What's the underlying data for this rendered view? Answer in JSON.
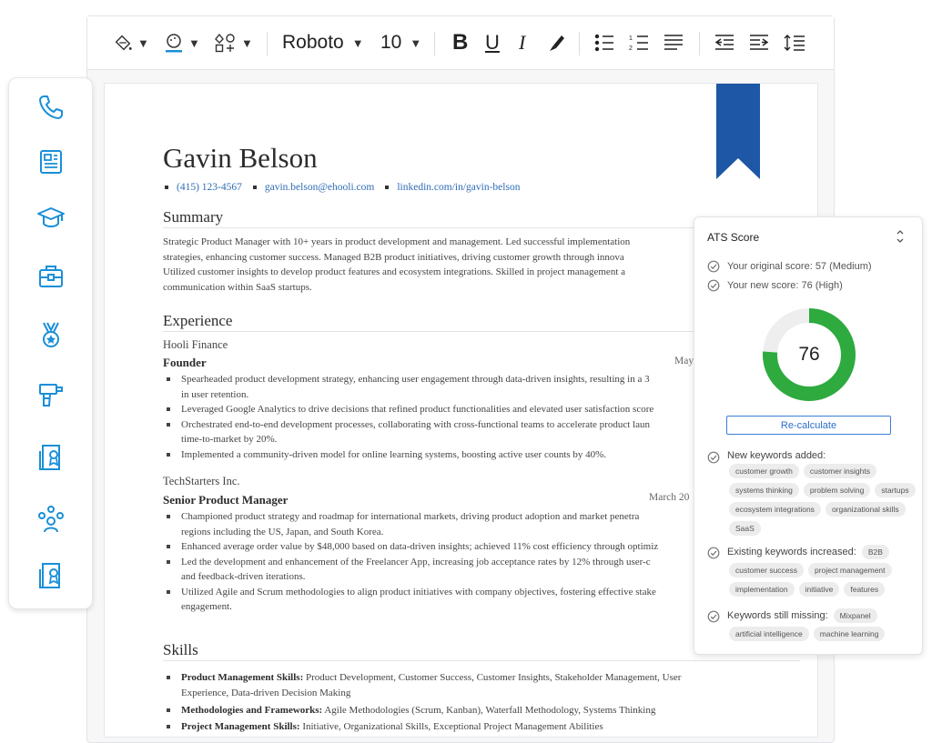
{
  "toolbar": {
    "font_family": "Roboto",
    "font_size": "10",
    "bold": "B",
    "underline": "U",
    "italic": "I"
  },
  "sidebar": {
    "items": [
      {
        "icon": "phone-icon"
      },
      {
        "icon": "summary-icon"
      },
      {
        "icon": "education-icon"
      },
      {
        "icon": "briefcase-icon"
      },
      {
        "icon": "award-icon"
      },
      {
        "icon": "tools-icon"
      },
      {
        "icon": "certificate-icon"
      },
      {
        "icon": "team-icon"
      },
      {
        "icon": "certificate-icon"
      }
    ],
    "accent": "#1a8fd8"
  },
  "resume": {
    "name": "Gavin Belson",
    "phone": "(415) 123-4567",
    "email": "gavin.belson@ehooli.com",
    "linkedin": "linkedin.com/in/gavin-belson",
    "summary_title": "Summary",
    "summary_lines": [
      "Strategic Product Manager with 10+ years in product development and management. Led successful implementation",
      "strategies, enhancing customer success. Managed B2B product initiatives, driving customer growth through innova",
      "Utilized customer insights to develop product features and ecosystem integrations. Skilled in project management a",
      "communication within SaaS startups."
    ],
    "experience_title": "Experience",
    "jobs": [
      {
        "company": "Hooli Finance",
        "role": "Founder",
        "date": "May",
        "bullets": [
          [
            "Spearheaded product development strategy, enhancing user engagement through data-driven insights, resulting in a 3",
            "in user retention."
          ],
          [
            "Leveraged Google Analytics to drive decisions that refined product functionalities and elevated user satisfaction score"
          ],
          [
            "Orchestrated end-to-end development processes, collaborating with cross-functional teams to accelerate product laun",
            "time-to-market by 20%."
          ],
          [
            "Implemented a community-driven model for online learning systems, boosting active user counts by 40%."
          ]
        ]
      },
      {
        "company": "TechStarters Inc.",
        "role": "Senior Product Manager",
        "date": "March 20",
        "bullets": [
          [
            "Championed product strategy and roadmap for international markets, driving product adoption and market penetra",
            "regions including the US, Japan, and South Korea."
          ],
          [
            "Enhanced average order value by $48,000 based on data-driven insights; achieved 11% cost efficiency through optimiz"
          ],
          [
            "Led the development and enhancement of the Freelancer App, increasing job acceptance rates by 12% through user-c",
            "and feedback-driven iterations."
          ],
          [
            "Utilized Agile and Scrum methodologies to align product initiatives with company objectives, fostering effective stake",
            "engagement."
          ]
        ]
      }
    ],
    "skills_title": "Skills",
    "skills": [
      {
        "label": "Product Management Skills:",
        "lines": [
          " Product Development, Customer Success, Customer Insights, Stakeholder Management, User",
          "Experience, Data-driven Decision Making"
        ]
      },
      {
        "label": "Methodologies and Frameworks:",
        "lines": [
          " Agile Methodologies (Scrum, Kanban), Waterfall Methodology, Systems Thinking"
        ]
      },
      {
        "label": "Project Management Skills:",
        "lines": [
          " Initiative, Organizational Skills, Exceptional Project Management Abilities"
        ]
      }
    ]
  },
  "ats": {
    "title": "ATS Score",
    "original_score": "Your original score: 57 (Medium)",
    "new_score": "Your new score: 76 (High)",
    "score": 76,
    "score_label": "76",
    "recalculate": "Re-calculate",
    "new_keywords_label": "New keywords added:",
    "new_keywords": [
      "customer growth",
      "customer insights",
      "systems thinking",
      "problem solving",
      "startups",
      "ecosystem integrations",
      "organizational skills",
      "SaaS"
    ],
    "increased_label": "Existing keywords increased:",
    "increased_inline": "B2B",
    "increased_keywords": [
      "customer success",
      "project management",
      "implementation",
      "initiative",
      "features"
    ],
    "missing_label": "Keywords still missing:",
    "missing_inline": "Mixpanel",
    "missing_keywords": [
      "artificial intelligence",
      "machine learning"
    ],
    "gauge_color": "#2eaa3f"
  }
}
